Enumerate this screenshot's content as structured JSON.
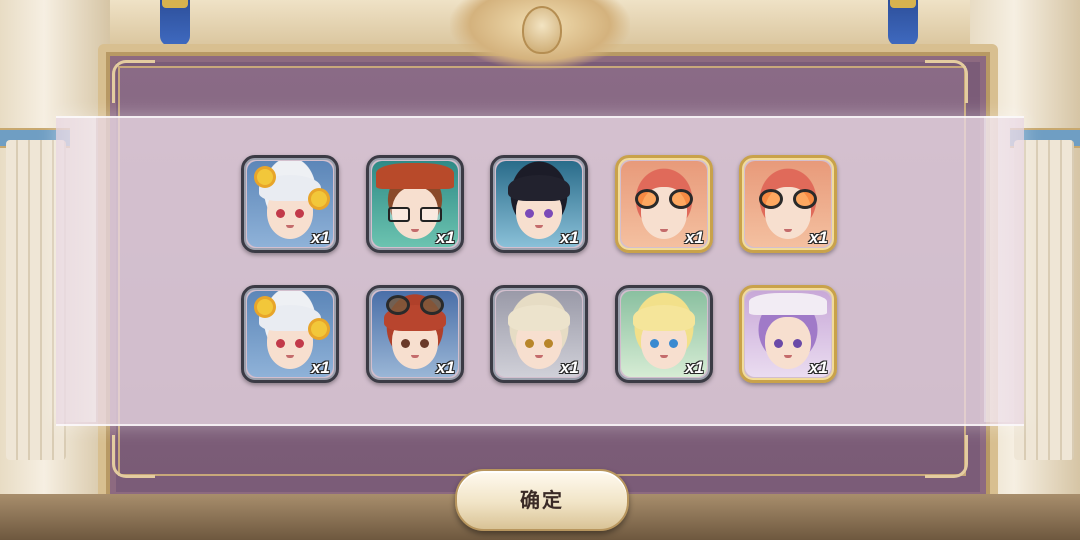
{
  "rewards": [
    {
      "name": "silver-hair-nun",
      "quantity": "x1",
      "frame": "silver"
    },
    {
      "name": "glasses-cap-girl",
      "quantity": "x1",
      "frame": "silver"
    },
    {
      "name": "dark-hair-girl",
      "quantity": "x1",
      "frame": "silver"
    },
    {
      "name": "goggles-pink-hair-girl",
      "quantity": "x1",
      "frame": "gold"
    },
    {
      "name": "goggles-pink-hair-girl",
      "quantity": "x1",
      "frame": "gold"
    },
    {
      "name": "silver-hair-nun",
      "quantity": "x1",
      "frame": "silver"
    },
    {
      "name": "red-hair-boy-goggles",
      "quantity": "x1",
      "frame": "silver"
    },
    {
      "name": "blonde-hair-girl",
      "quantity": "x1",
      "frame": "silver"
    },
    {
      "name": "elf-blonde-girl",
      "quantity": "x1",
      "frame": "silver"
    },
    {
      "name": "purple-hair-girl",
      "quantity": "x1",
      "frame": "gold"
    }
  ],
  "confirm_label": "确定",
  "colors": {
    "panel_bg": "#e9d9e4",
    "frame_gold": "#c9a24a",
    "frame_silver": "#3b3b45",
    "quantity_text": "#ffffff"
  }
}
